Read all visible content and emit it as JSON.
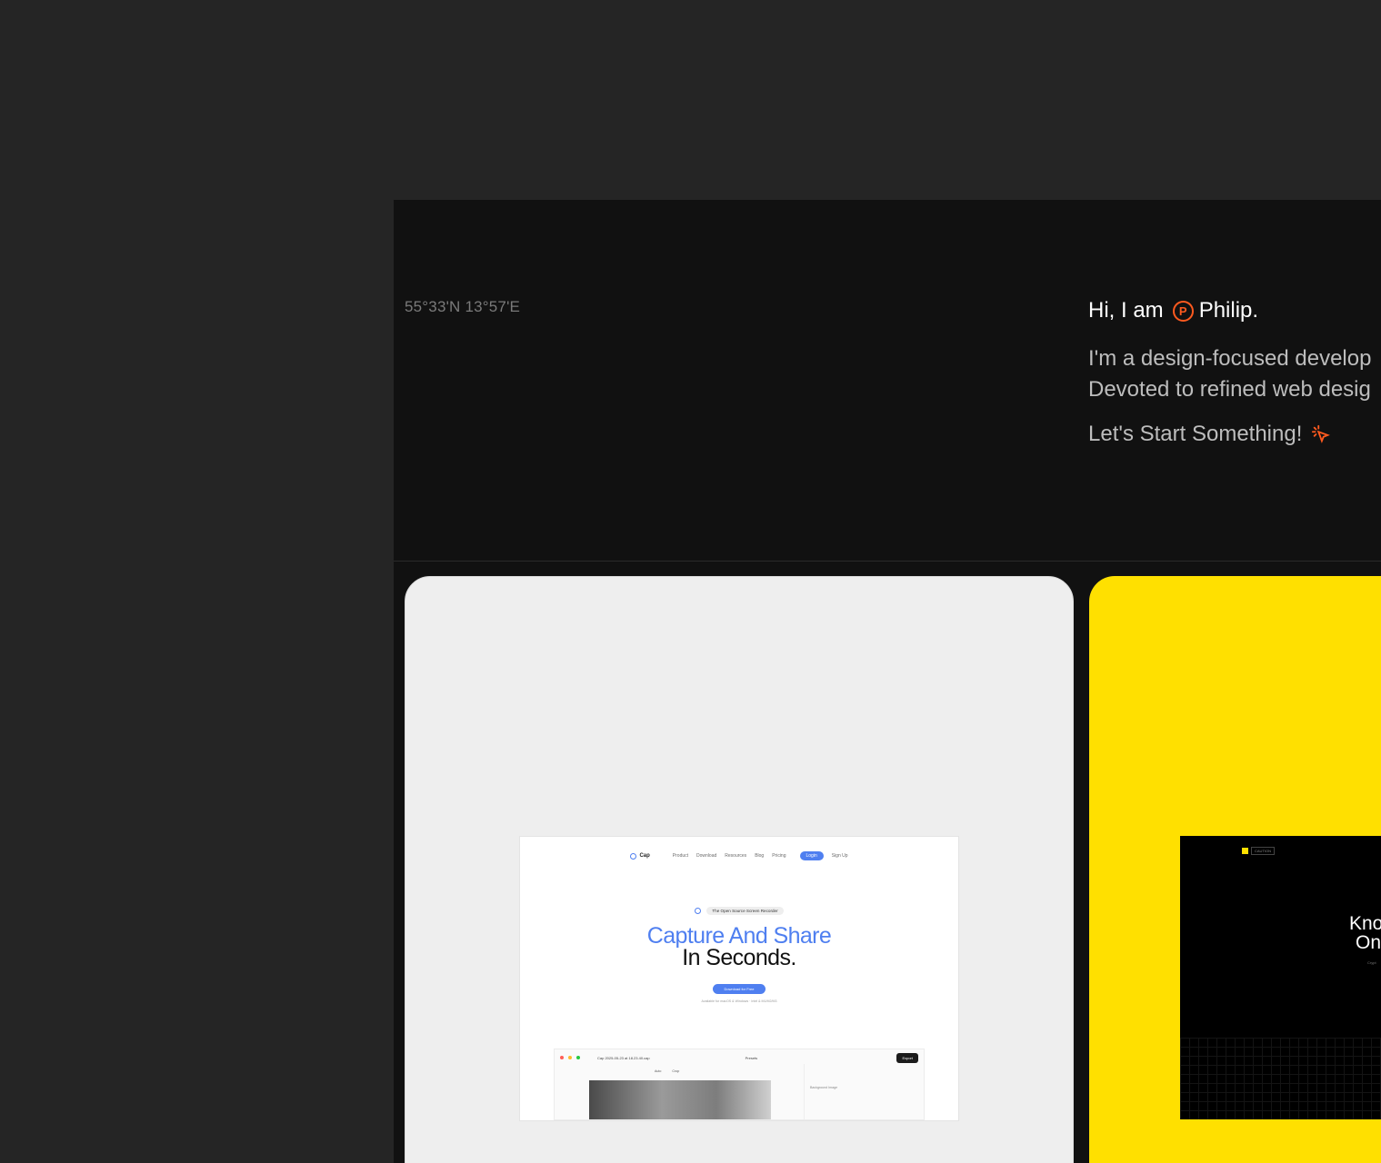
{
  "hero": {
    "coords": "55°33'N 13°57'E",
    "greeting_prefix": "Hi, I am",
    "badge_letter": "P",
    "name": "Philip.",
    "desc_line1": "I'm a design-focused develop",
    "desc_line2": "Devoted to refined web desig",
    "cta": "Let's Start Something!"
  },
  "projects": {
    "cap": {
      "logo": "Cap",
      "nav": [
        "Product",
        "Download",
        "Resources",
        "Blog",
        "Pricing"
      ],
      "login": "Login",
      "signup": "Sign Up",
      "pill": "The Open Source Screen Recorder",
      "headline_line1": "Capture And Share",
      "headline_line2": "In Seconds.",
      "download": "Download for Free",
      "subnote": "Available for macOS & Windows · Intel & M1/M2/M3",
      "app": {
        "filename": "Cap 2025-05-23 at 18.23.40.cap",
        "presets": "Presets",
        "export": "Export",
        "auto": "Auto",
        "crop": "Crop",
        "background": "Background Image"
      }
    },
    "yellow": {
      "logo_text": "CAUTION",
      "headline_line1": "Kno",
      "headline_line2": "On",
      "sub": "Crypt"
    }
  },
  "colors": {
    "accent_orange": "#ff5a1f",
    "cap_blue": "#4f7ff0",
    "yellow": "#ffe000"
  }
}
